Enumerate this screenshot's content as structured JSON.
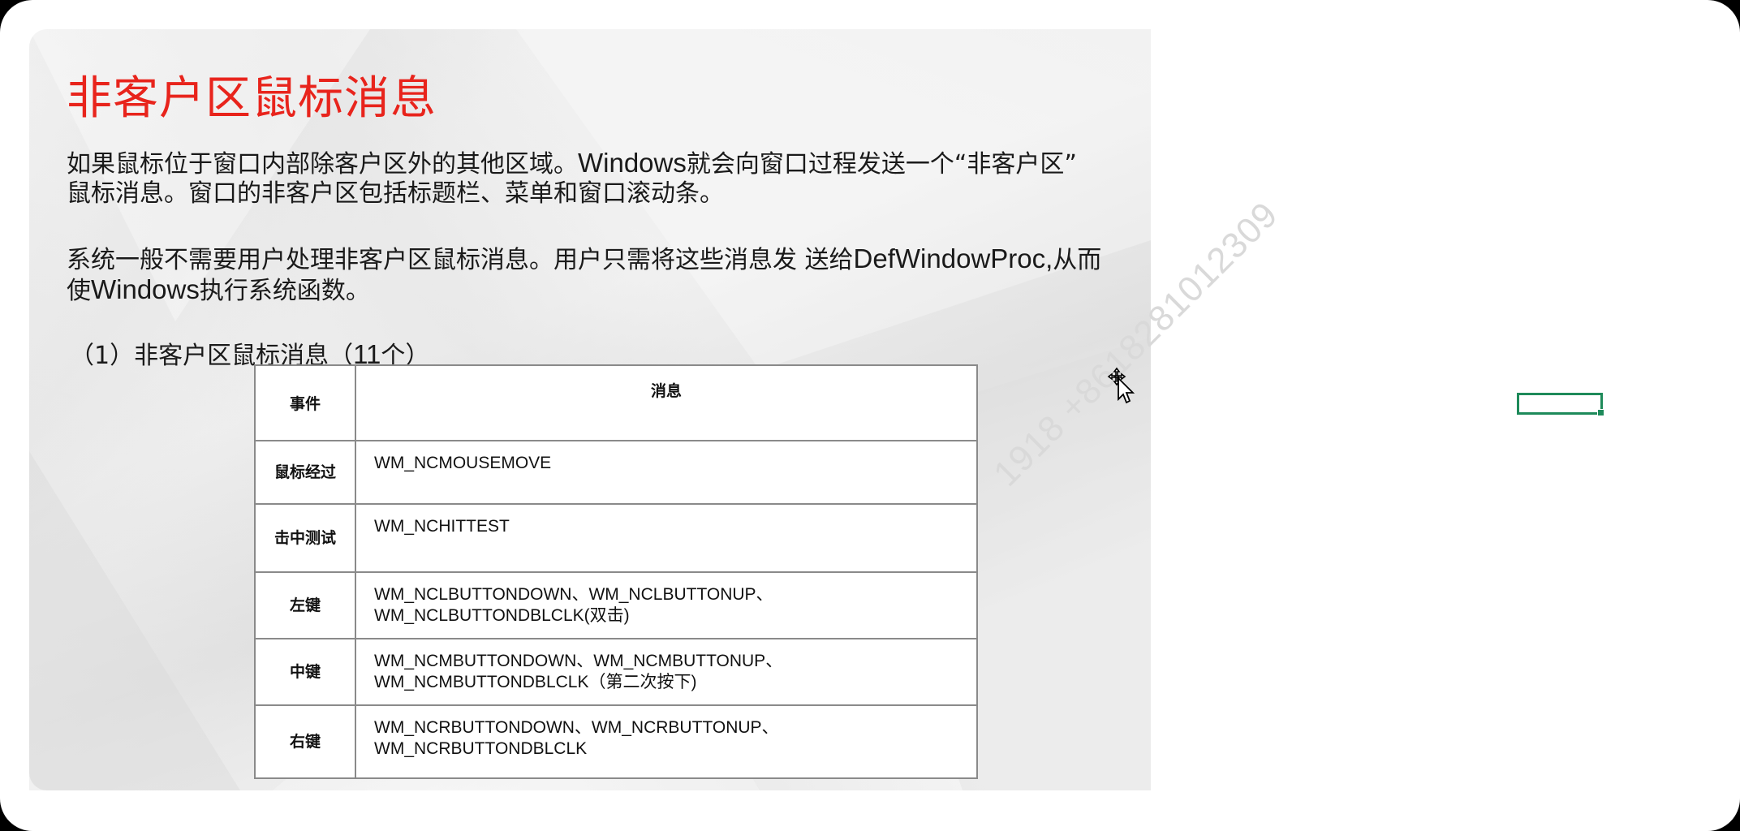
{
  "slide": {
    "title": "非客户区鼠标消息",
    "paragraph1": {
      "line1_a": "如果鼠标位于窗口内部除客户区外的其他区域。",
      "line1_b": "Windows",
      "line1_c": "就会向窗口过程发送一个“非客户区”",
      "line2": "鼠标消息。窗口的非客户区包括标题栏、菜单和窗口滚动条。"
    },
    "paragraph2": {
      "line1_a": "系统一般不需要用户处理非客户区鼠标消息。用户只需将这些消息发 送给",
      "line1_b": "DefWindowProc,",
      "line1_c": "从而",
      "line2_a": "使",
      "line2_b": "Windows",
      "line2_c": "执行系统函数。"
    },
    "subheading": {
      "prefix": "（1）非客户区鼠标消息（",
      "count": "11",
      "suffix": "个）"
    },
    "table": {
      "headers": [
        "事件",
        "消息"
      ],
      "rows": [
        {
          "event": "鼠标经过",
          "message_line1": "WM_NCMOUSEMOVE",
          "message_line2": ""
        },
        {
          "event": "击中测试",
          "message_line1": "WM_NCHITTEST",
          "message_line2": ""
        },
        {
          "event": "左键",
          "message_line1": "WM_NCLBUTTONDOWN、WM_NCLBUTTONUP、",
          "message_line2": "WM_NCLBUTTONDBLCLK(双击)"
        },
        {
          "event": "中键",
          "message_line1": "WM_NCMBUTTONDOWN、WM_NCMBUTTONUP、",
          "message_line2": "WM_NCMBUTTONDBLCLK（第二次按下)"
        },
        {
          "event": "右键",
          "message_line1": "WM_NCRBUTTONDOWN、WM_NCRBUTTONUP、",
          "message_line2": "WM_NCRBUTTONDBLCLK"
        }
      ]
    }
  },
  "watermark": "1918 +8618281012309",
  "colors": {
    "title": "#e8241c",
    "selection": "#1e8a5a",
    "watermark": "#d9d9d9"
  },
  "icons": {
    "cursor": "move-cursor-icon",
    "selection": "spreadsheet-cell-selection"
  }
}
